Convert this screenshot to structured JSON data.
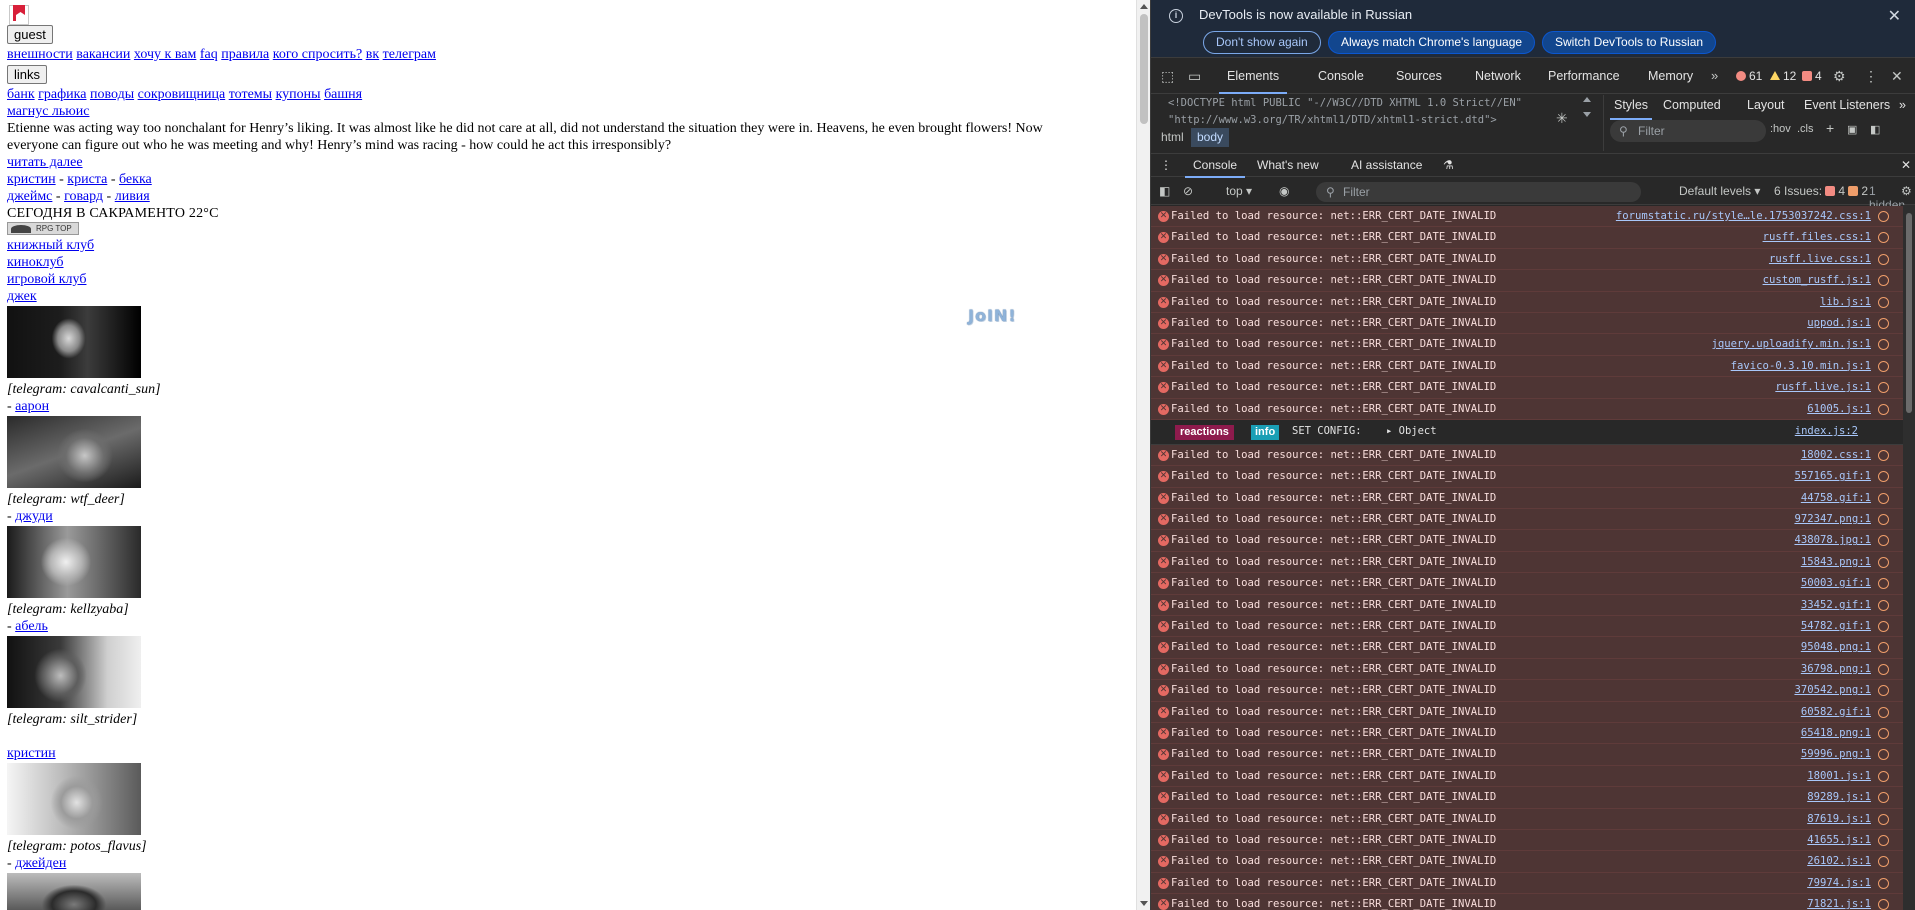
{
  "page": {
    "guest_button": "guest",
    "nav1": [
      "внешности",
      "вакансии",
      "хочу к вам",
      "faq",
      "правила",
      "кого спросить?",
      "вк",
      "телеграм"
    ],
    "links_button": "links",
    "nav2": [
      "банк",
      "графика",
      "поводы",
      "сокровищница",
      "тотемы",
      "купоны",
      "башня"
    ],
    "featured_name": "магнус льюис",
    "story": "Etienne was acting way too nonchalant for Henry’s liking. It was almost like he did not care at all, did not understand the situation they were in. Heavens, he even brought flowers! Now everyone can figure out who he was meeting and why! Henry’s mind was racing - how could he act this irresponsibly?",
    "read_more": "читать далее",
    "pair1": [
      "кристин",
      "криста",
      "бекка"
    ],
    "pair2": [
      "джеймс",
      "говард",
      "ливия"
    ],
    "pair_sep": " - ",
    "today": "СЕГОДНЯ В САКРАМЕНТО 22°C",
    "rpg_top": "RPG TOP",
    "clubs": [
      "книжный клуб",
      "киноклуб",
      "игровой клуб",
      "джек"
    ],
    "entries": [
      {
        "telegram": "[telegram: cavalcanti_sun]",
        "link": "аарон"
      },
      {
        "telegram": "[telegram: wtf_deer]",
        "link": "джуди"
      },
      {
        "telegram": "[telegram: kellzyaba]",
        "link": "абель"
      },
      {
        "telegram": "[telegram: silt_strider]",
        "link": ""
      },
      {
        "telegram": "[telegram: potos_flavus]",
        "link": "джейден"
      }
    ],
    "entry_prefix": "- ",
    "standalone_link": "кристин",
    "bubble_text": "JoIN!"
  },
  "devtools": {
    "info_message": "DevTools is now available in Russian",
    "btn_dont_show": "Don't show again",
    "btn_match": "Always match Chrome's language",
    "btn_switch": "Switch DevTools to Russian",
    "tabs": [
      "Elements",
      "Console",
      "Sources",
      "Network",
      "Performance",
      "Memory"
    ],
    "error_count": "61",
    "warning_count": "12",
    "issue_count": "4",
    "doctype_line1": "<!DOCTYPE html PUBLIC \"-//W3C//DTD XHTML 1.0 Strict//EN\"",
    "doctype_line2": "\"http://www.w3.org/TR/xhtml1/DTD/xhtml1-strict.dtd\">",
    "crumbs": [
      "html",
      "body"
    ],
    "styles_tabs": [
      "Styles",
      "Computed",
      "Layout",
      "Event Listeners"
    ],
    "styles_filter": "Filter",
    "hov": ":hov",
    "cls": ".cls",
    "drawer_tabs": [
      "Console",
      "What's new",
      "AI assistance"
    ],
    "context": "top",
    "console_filter": "Filter",
    "levels": "Default levels",
    "issues_label": "6 Issues:",
    "issues_err": "4",
    "issues_warn": "2",
    "hidden": "1 hidden",
    "error_text": "Failed to load resource: net::ERR_CERT_DATE_INVALID",
    "info_row": {
      "tag1": "reactions",
      "tag2": "info",
      "text": "SET CONFIG:",
      "obj": "▸ Object",
      "src": "index.js:2"
    },
    "log_sources_before": [
      "forumstatic.ru/style…le.1753037242.css:1",
      "rusff.files.css:1",
      "rusff.live.css:1",
      "custom_rusff.js:1",
      "lib.js:1",
      "uppod.js:1",
      "jquery.uploadify.min.js:1",
      "favico-0.3.10.min.js:1",
      "rusff.live.js:1",
      "61005.js:1"
    ],
    "log_sources_after": [
      "18002.css:1",
      "557165.gif:1",
      "44758.gif:1",
      "972347.png:1",
      "438078.jpg:1",
      "15843.png:1",
      "50003.gif:1",
      "33452.gif:1",
      "54782.gif:1",
      "95048.png:1",
      "36798.png:1",
      "370542.png:1",
      "60582.gif:1",
      "65418.png:1",
      "59996.png:1",
      "18001.js:1",
      "89289.js:1",
      "87619.js:1",
      "41655.js:1",
      "26102.js:1",
      "79974.js:1",
      "71821.js:1"
    ]
  }
}
